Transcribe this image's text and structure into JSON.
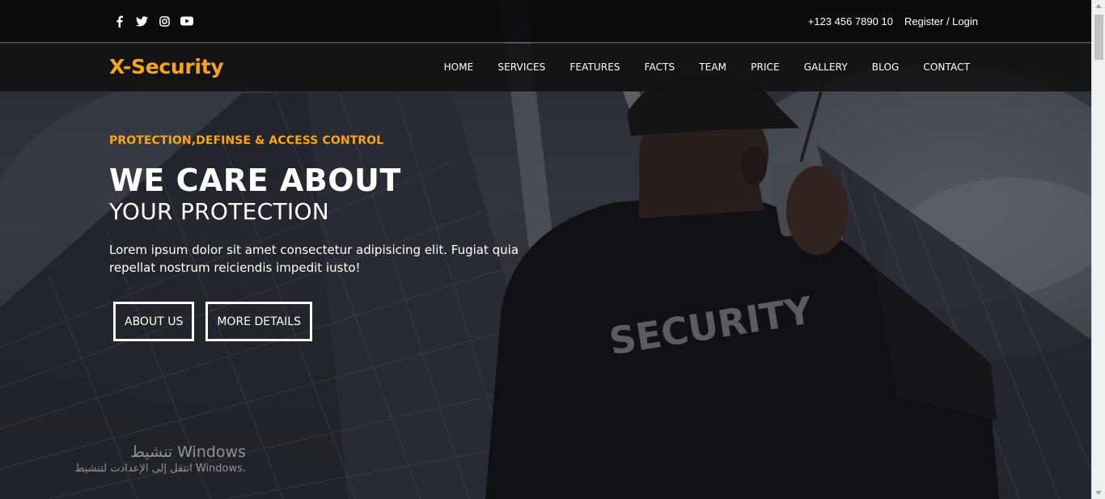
{
  "topbar": {
    "social": [
      {
        "icon": "facebook-icon"
      },
      {
        "icon": "twitter-icon"
      },
      {
        "icon": "instagram-icon"
      },
      {
        "icon": "youtube-icon"
      }
    ],
    "phone": "+123 456 7890 10",
    "auth_label": "Register / Login"
  },
  "nav": {
    "logo": "X-Security",
    "items": [
      "HOME",
      "SERVICES",
      "FEATURES",
      "FACTS",
      "TEAM",
      "PRICE",
      "GALLERY",
      "BLOG",
      "CONTACT"
    ]
  },
  "hero": {
    "kicker": "PROTECTION,DEFINSE & ACCESS CONTROL",
    "headline": "WE CARE ABOUT",
    "subheadline": "YOUR PROTECTION",
    "lead": "Lorem ipsum dolor sit amet consectetur adipisicing elit. Fugiat quia repellat nostrum reiciendis impedit iusto!",
    "buttons": {
      "about": "ABOUT US",
      "details": "MORE DETAILS"
    },
    "jacket_text": "SECURITY"
  },
  "system": {
    "activation_title": "تنشيط Windows",
    "activation_subtitle": "انتقل إلى الإعدادت لتنشيط Windows."
  },
  "colors": {
    "accent": "#f5a51c",
    "bar_bg": "#08080a",
    "text": "#ffffff"
  }
}
